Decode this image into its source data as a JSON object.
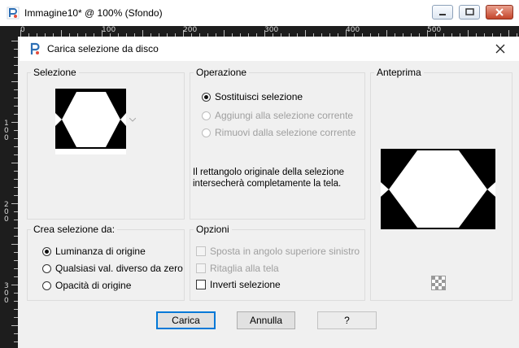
{
  "window": {
    "title": "Immagine10* @ 100% (Sfondo)",
    "buttons": [
      "minimize-icon",
      "maximize-icon",
      "close-icon"
    ]
  },
  "ruler": {
    "top_labels": [
      "0",
      "100",
      "200",
      "300",
      "400",
      "500"
    ],
    "left_labels": [
      "100",
      "200",
      "300"
    ]
  },
  "dialog": {
    "title": "Carica selezione da disco",
    "selezione": {
      "label": "Selezione"
    },
    "operazione": {
      "label": "Operazione",
      "options": [
        {
          "label": "Sostituisci selezione",
          "selected": true,
          "enabled": true
        },
        {
          "label": "Aggiungi alla selezione corrente",
          "selected": false,
          "enabled": false
        },
        {
          "label": "Rimuovi dalla selezione corrente",
          "selected": false,
          "enabled": false
        }
      ],
      "info": "Il rettangolo originale della selezione intersecherà completamente la tela."
    },
    "anteprima": {
      "label": "Anteprima"
    },
    "crea": {
      "label": "Crea selezione da:",
      "options": [
        {
          "label": "Luminanza di origine",
          "selected": true
        },
        {
          "label": "Qualsiasi val. diverso da zero",
          "selected": false
        },
        {
          "label": "Opacità di origine",
          "selected": false
        }
      ]
    },
    "opzioni": {
      "label": "Opzioni",
      "checks": [
        {
          "label": "Sposta in angolo superiore sinistro",
          "checked": false,
          "enabled": false
        },
        {
          "label": "Ritaglia alla tela",
          "checked": false,
          "enabled": false
        },
        {
          "label": "Inverti selezione",
          "checked": false,
          "enabled": true
        }
      ]
    },
    "buttons": {
      "load": "Carica",
      "cancel": "Annulla",
      "help": "?"
    }
  }
}
